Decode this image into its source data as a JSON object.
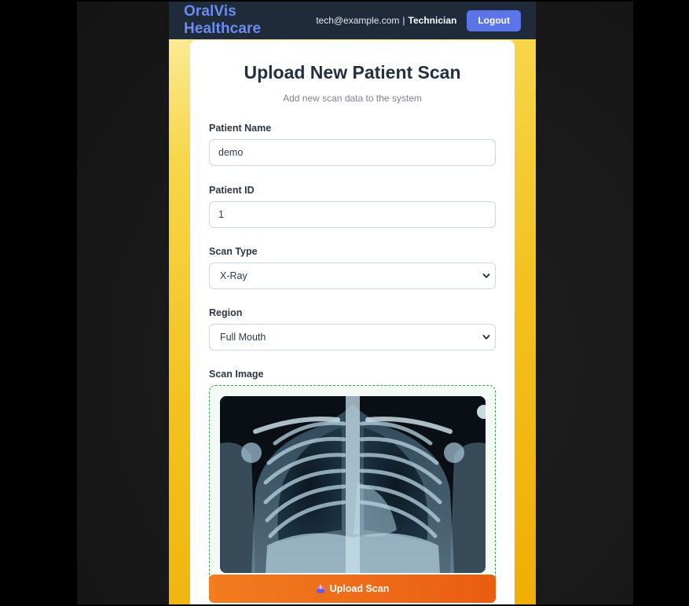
{
  "navbar": {
    "brand": "OralVis Healthcare",
    "user_email": "tech@example.com",
    "separator": "|",
    "user_role": "Technician",
    "logout_label": "Logout"
  },
  "form": {
    "title": "Upload New Patient Scan",
    "subtitle": "Add new scan data to the system",
    "patient_name": {
      "label": "Patient Name",
      "value": "demo"
    },
    "patient_id": {
      "label": "Patient ID",
      "value": "1"
    },
    "scan_type": {
      "label": "Scan Type",
      "selected": "X-Ray"
    },
    "region": {
      "label": "Region",
      "selected": "Full Mouth"
    },
    "scan_image": {
      "label": "Scan Image",
      "preview": "chest x-ray image"
    },
    "submit_label": "Upload Scan",
    "submit_icon": "upload-box-icon"
  },
  "colors": {
    "navbar_bg": "#1f2a3b",
    "brand": "#6c8cf0",
    "logout_bg": "#5b74e8",
    "upload_start": "#f27c20",
    "upload_end": "#ea5d12",
    "dropzone_border": "#3fa15b",
    "page_gradient_end": "#f0ae05"
  }
}
